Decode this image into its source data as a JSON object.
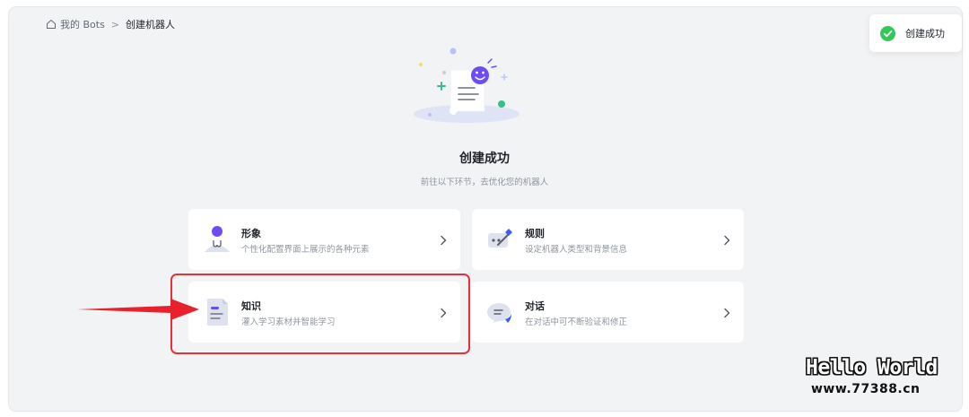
{
  "breadcrumb": {
    "home_label": "我的 Bots",
    "separator": ">",
    "current": "创建机器人"
  },
  "toast": {
    "text": "创建成功",
    "status_color": "#34c759"
  },
  "main": {
    "title": "创建成功",
    "subtitle": "前往以下环节，去优化您的机器人"
  },
  "cards": [
    {
      "title": "形象",
      "desc": "个性化配置界面上展示的各种元素",
      "icon": "avatar-person-icon"
    },
    {
      "title": "规则",
      "desc": "设定机器人类型和背景信息",
      "icon": "rules-edit-icon"
    },
    {
      "title": "知识",
      "desc": "灌入学习素材并智能学习",
      "icon": "knowledge-document-icon"
    },
    {
      "title": "对话",
      "desc": "在对话中可不断验证和修正",
      "icon": "chat-bubble-icon"
    }
  ],
  "annotation": {
    "highlight_color": "#e8303b"
  },
  "watermark": {
    "title": "Hello World",
    "url": "www.77388.cn"
  },
  "colors": {
    "accent": "#6e4cf5",
    "background": "#f2f3f5",
    "card": "#ffffff"
  }
}
